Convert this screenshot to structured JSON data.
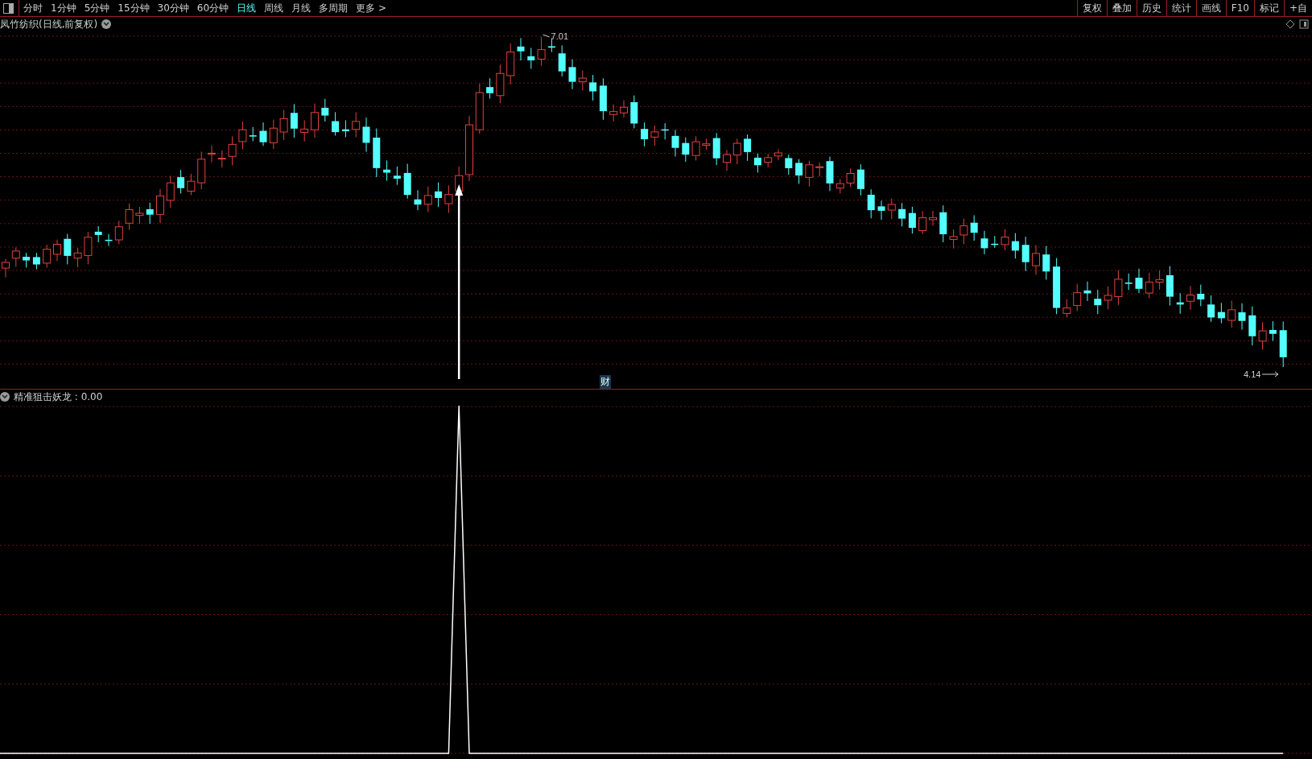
{
  "toolbar": {
    "periods": [
      {
        "label": "分时",
        "selected": false
      },
      {
        "label": "1分钟",
        "selected": false
      },
      {
        "label": "5分钟",
        "selected": false
      },
      {
        "label": "15分钟",
        "selected": false
      },
      {
        "label": "30分钟",
        "selected": false
      },
      {
        "label": "60分钟",
        "selected": false
      },
      {
        "label": "日线",
        "selected": true
      },
      {
        "label": "周线",
        "selected": false
      },
      {
        "label": "月线",
        "selected": false
      },
      {
        "label": "多周期",
        "selected": false
      },
      {
        "label": "更多 >",
        "selected": false
      }
    ],
    "actions": [
      "复权",
      "叠加",
      "历史",
      "统计",
      "画线",
      "F10",
      "标记",
      "+自"
    ]
  },
  "main_chart": {
    "title": "凤竹纺织(日线,前复权)",
    "high_label": "7.01",
    "low_label": "4.14",
    "event_marker": "财"
  },
  "indicator": {
    "label": "精准狙击妖龙 : 0.00"
  }
}
